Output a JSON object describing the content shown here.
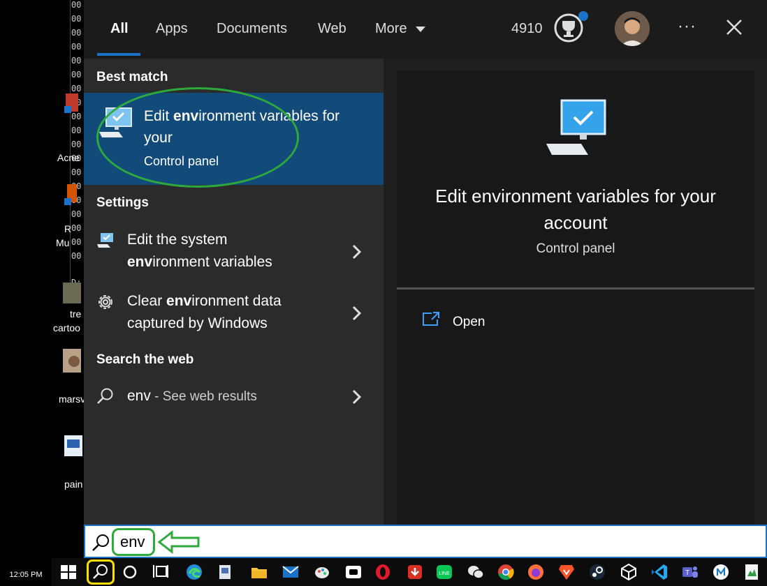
{
  "desktop": {
    "console_lines": [
      "00",
      "00",
      "00",
      "00",
      "00",
      "00",
      "00",
      "00",
      "00",
      "00",
      "00",
      "00",
      "00",
      "00",
      "00",
      "00",
      "00",
      "00",
      "00",
      "D:"
    ],
    "labels": [
      "Acne",
      "R",
      "Mu",
      "tre",
      "cartoo",
      "marsv",
      "pain"
    ]
  },
  "tabs": [
    {
      "label": "All"
    },
    {
      "label": "Apps"
    },
    {
      "label": "Documents"
    },
    {
      "label": "Web"
    },
    {
      "label": "More"
    }
  ],
  "header": {
    "points": "4910",
    "more_dots": "···",
    "close_icon": "close-icon"
  },
  "results": {
    "best_match_heading": "Best match",
    "best_match": {
      "title_pre": "Edit ",
      "title_bold": "env",
      "title_post": "ironment variables for your",
      "subtitle": "Control panel"
    },
    "settings_heading": "Settings",
    "settings_items": [
      {
        "line1": "Edit the system",
        "bold": "env",
        "line2_post": "ironment variables"
      },
      {
        "pre": "Clear ",
        "bold": "env",
        "post": "ironment data",
        "line2": "captured by Windows"
      }
    ],
    "web_heading": "Search the web",
    "web_item": {
      "query": "env",
      "hint": " - See web results"
    }
  },
  "preview": {
    "title": "Edit environment variables for your account",
    "subtitle": "Control panel",
    "open_label": "Open"
  },
  "search": {
    "value": "env"
  },
  "taskbar": {
    "clock": "12:05 PM",
    "accent": "#1a73c8",
    "highlight_color": "#ffde00",
    "annotation_color": "#2eaa3c"
  }
}
